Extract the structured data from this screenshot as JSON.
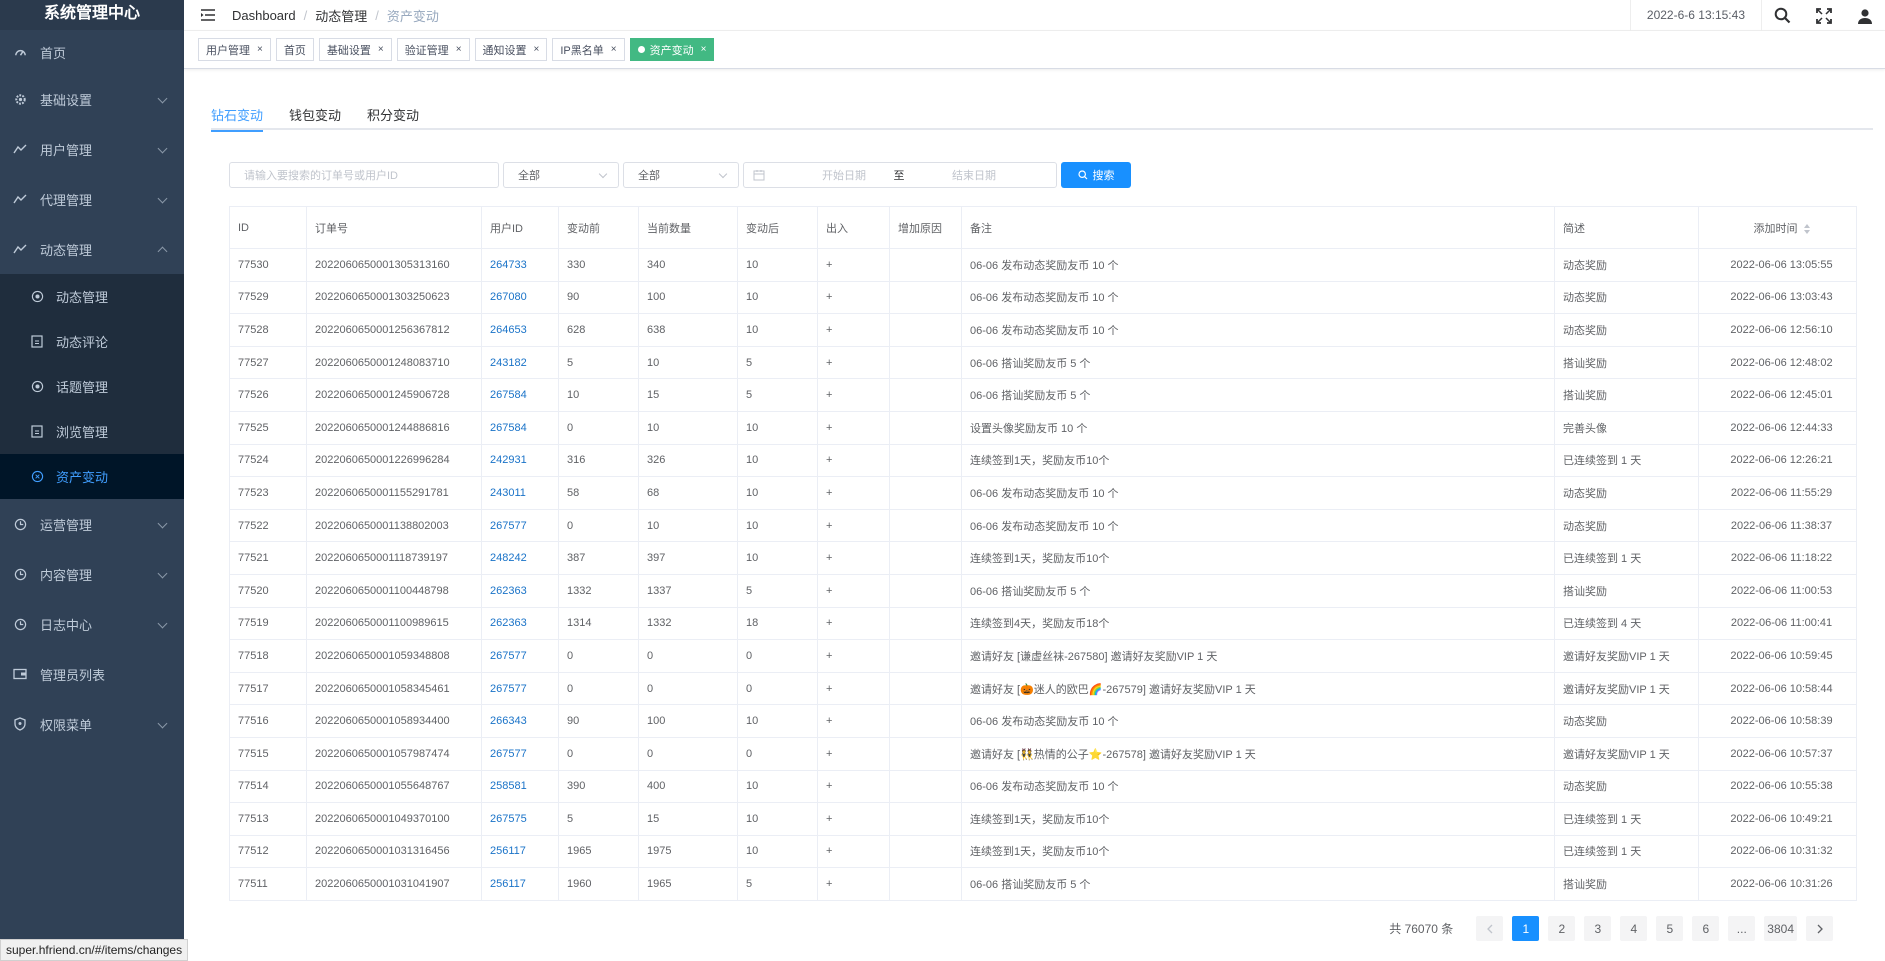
{
  "sidebar": {
    "title": "系统管理中心",
    "items": [
      {
        "label": "首页",
        "icon": "dashboard-icon"
      },
      {
        "label": "基础设置",
        "icon": "gear-icon"
      },
      {
        "label": "用户管理",
        "icon": "user-icon"
      },
      {
        "label": "代理管理",
        "icon": "agent-icon"
      },
      {
        "label": "动态管理",
        "icon": "moment-icon"
      }
    ],
    "submenu": [
      {
        "label": "动态管理",
        "icon": "circle-icon"
      },
      {
        "label": "动态评论",
        "icon": "comment-icon"
      },
      {
        "label": "话题管理",
        "icon": "topic-icon"
      },
      {
        "label": "浏览管理",
        "icon": "view-icon"
      },
      {
        "label": "资产变动",
        "icon": "asset-icon"
      }
    ],
    "items_after": [
      {
        "label": "运营管理",
        "icon": "clock-icon"
      },
      {
        "label": "内容管理",
        "icon": "clock-icon"
      },
      {
        "label": "日志中心",
        "icon": "clock-icon"
      },
      {
        "label": "管理员列表",
        "icon": "wallet-icon"
      },
      {
        "label": "权限菜单",
        "icon": "shield-icon"
      }
    ]
  },
  "header": {
    "breadcrumb": [
      "Dashboard",
      "动态管理",
      "资产变动"
    ],
    "datetime": "2022-6-6 13:15:43"
  },
  "tags": [
    "用户管理",
    "首页",
    "基础设置",
    "验证管理",
    "通知设置",
    "IP黑名单",
    "资产变动"
  ],
  "tabs": [
    "钻石变动",
    "钱包变动",
    "积分变动"
  ],
  "filters": {
    "search_placeholder": "请输入要搜索的订单号或用户ID",
    "select1": "全部",
    "select2": "全部",
    "start_placeholder": "开始日期",
    "to": "至",
    "end_placeholder": "结束日期",
    "search_button": "搜索"
  },
  "table": {
    "headers": [
      "ID",
      "订单号",
      "用户ID",
      "变动前",
      "当前数量",
      "变动后",
      "出入",
      "增加原因",
      "备注",
      "简述",
      "添加时间"
    ],
    "rows": [
      [
        "77530",
        "202206065000130531316​0",
        "264733",
        "330",
        "340",
        "10",
        "+",
        "",
        "06-06 发布动态奖励友币 10 个",
        "动态奖励",
        "2022-06-06 13:05:55"
      ],
      [
        "77529",
        "2022060650001303250623",
        "267080",
        "90",
        "100",
        "10",
        "+",
        "",
        "06-06 发布动态奖励友币 10 个",
        "动态奖励",
        "2022-06-06 13:03:43"
      ],
      [
        "77528",
        "2022060650001256367812",
        "264653",
        "628",
        "638",
        "10",
        "+",
        "",
        "06-06 发布动态奖励友币 10 个",
        "动态奖励",
        "2022-06-06 12:56:10"
      ],
      [
        "77527",
        "2022060650001248083710",
        "243182",
        "5",
        "10",
        "5",
        "+",
        "",
        "06-06 搭讪奖励友币 5 个",
        "搭讪奖励",
        "2022-06-06 12:48:02"
      ],
      [
        "77526",
        "2022060650001245906728",
        "267584",
        "10",
        "15",
        "5",
        "+",
        "",
        "06-06 搭讪奖励友币 5 个",
        "搭讪奖励",
        "2022-06-06 12:45:01"
      ],
      [
        "77525",
        "2022060650001244886816",
        "267584",
        "0",
        "10",
        "10",
        "+",
        "",
        "设置头像奖励友币 10 个",
        "完善头像",
        "2022-06-06 12:44:33"
      ],
      [
        "77524",
        "2022060650001226996284",
        "242931",
        "316",
        "326",
        "10",
        "+",
        "",
        "连续签到1天，奖励友币10个",
        "已连续签到 1 天",
        "2022-06-06 12:26:21"
      ],
      [
        "77523",
        "2022060650001155291781",
        "243011",
        "58",
        "68",
        "10",
        "+",
        "",
        "06-06 发布动态奖励友币 10 个",
        "动态奖励",
        "2022-06-06 11:55:29"
      ],
      [
        "77522",
        "2022060650001138802003",
        "267577",
        "0",
        "10",
        "10",
        "+",
        "",
        "06-06 发布动态奖励友币 10 个",
        "动态奖励",
        "2022-06-06 11:38:37"
      ],
      [
        "77521",
        "2022060650001118739197",
        "248242",
        "387",
        "397",
        "10",
        "+",
        "",
        "连续签到1天，奖励友币10个",
        "已连续签到 1 天",
        "2022-06-06 11:18:22"
      ],
      [
        "77520",
        "2022060650001100448798",
        "262363",
        "1332",
        "1337",
        "5",
        "+",
        "",
        "06-06 搭讪奖励友币 5 个",
        "搭讪奖励",
        "2022-06-06 11:00:53"
      ],
      [
        "77519",
        "2022060650001100989615",
        "262363",
        "1314",
        "1332",
        "18",
        "+",
        "",
        "连续签到4天，奖励友币18个",
        "已连续签到 4 天",
        "2022-06-06 11:00:41"
      ],
      [
        "77518",
        "2022060650001059348808",
        "267577",
        "0",
        "0",
        "0",
        "+",
        "",
        "邀请好友 [谦虚丝袜-267580] 邀请好友奖励VIP 1 天",
        "邀请好友奖励VIP 1 天",
        "2022-06-06 10:59:45"
      ],
      [
        "77517",
        "2022060650001058345461",
        "267577",
        "0",
        "0",
        "0",
        "+",
        "",
        "邀请好友 [🎃迷人的欧巴🌈-267579] 邀请好友奖励VIP 1 天",
        "邀请好友奖励VIP 1 天",
        "2022-06-06 10:58:44"
      ],
      [
        "77516",
        "2022060650001058934400",
        "266343",
        "90",
        "100",
        "10",
        "+",
        "",
        "06-06 发布动态奖励友币 10 个",
        "动态奖励",
        "2022-06-06 10:58:39"
      ],
      [
        "77515",
        "2022060650001057987474",
        "267577",
        "0",
        "0",
        "0",
        "+",
        "",
        "邀请好友 [👯热情的公子⭐-267578] 邀请好友奖励VIP 1 天",
        "邀请好友奖励VIP 1 天",
        "2022-06-06 10:57:37"
      ],
      [
        "77514",
        "2022060650001055648767",
        "258581",
        "390",
        "400",
        "10",
        "+",
        "",
        "06-06 发布动态奖励友币 10 个",
        "动态奖励",
        "2022-06-06 10:55:38"
      ],
      [
        "77513",
        "2022060650001049370100",
        "267575",
        "5",
        "15",
        "10",
        "+",
        "",
        "连续签到1天，奖励友币10个",
        "已连续签到 1 天",
        "2022-06-06 10:49:21"
      ],
      [
        "77512",
        "2022060650001031316456",
        "256117",
        "1965",
        "1975",
        "10",
        "+",
        "",
        "连续签到1天，奖励友币10个",
        "已连续签到 1 天",
        "2022-06-06 10:31:32"
      ],
      [
        "77511",
        "2022060650001031041907",
        "256117",
        "1960",
        "1965",
        "5",
        "+",
        "",
        "06-06 搭讪奖励友币 5 个",
        "搭讪奖励",
        "2022-06-06 10:31:26"
      ]
    ]
  },
  "pagination": {
    "total": "共 76070 条",
    "pages": [
      "1",
      "2",
      "3",
      "4",
      "5",
      "6",
      "...",
      "3804"
    ],
    "current": "1"
  },
  "statusbar": "super.hfriend.cn/#/items/changes",
  "colors": {
    "sidebar_bg": "#304156",
    "accent": "#409eff",
    "tag_active": "#42b983",
    "primary_button": "#1890ff"
  }
}
